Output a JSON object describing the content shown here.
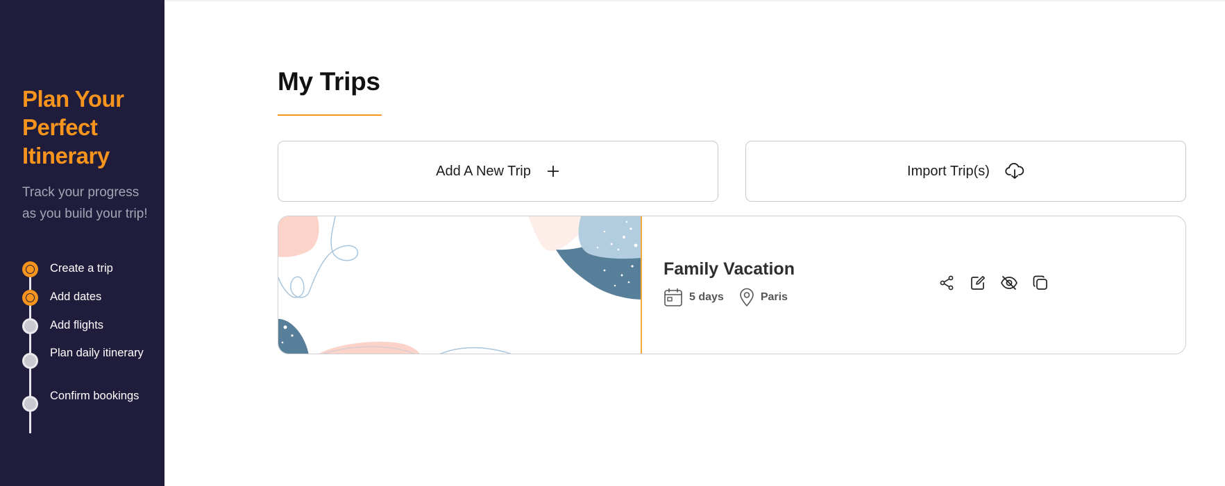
{
  "sidebar": {
    "title": "Plan Your Perfect Itinerary",
    "subtitle": "Track your progress as you build your trip!",
    "steps": [
      {
        "label": "Create a trip",
        "status": "done"
      },
      {
        "label": "Add dates",
        "status": "done"
      },
      {
        "label": "Add flights",
        "status": "todo"
      },
      {
        "label": "Plan daily itinerary",
        "status": "todo"
      },
      {
        "label": "Confirm bookings",
        "status": "todo"
      }
    ]
  },
  "main": {
    "title": "My Trips",
    "add_trip_label": "Add A New Trip",
    "import_label": "Import Trip(s)",
    "trips": [
      {
        "name": "Family Vacation",
        "duration": "5 days",
        "location": "Paris",
        "actions": [
          "share-icon",
          "edit-icon",
          "hide-icon",
          "duplicate-icon"
        ]
      }
    ]
  },
  "colors": {
    "accent": "#f7941d",
    "sidebar_bg": "#1f1d3b",
    "art_blue_dark": "#577f99",
    "art_blue_light": "#b3cde0",
    "art_peach": "#fbd3c9"
  }
}
